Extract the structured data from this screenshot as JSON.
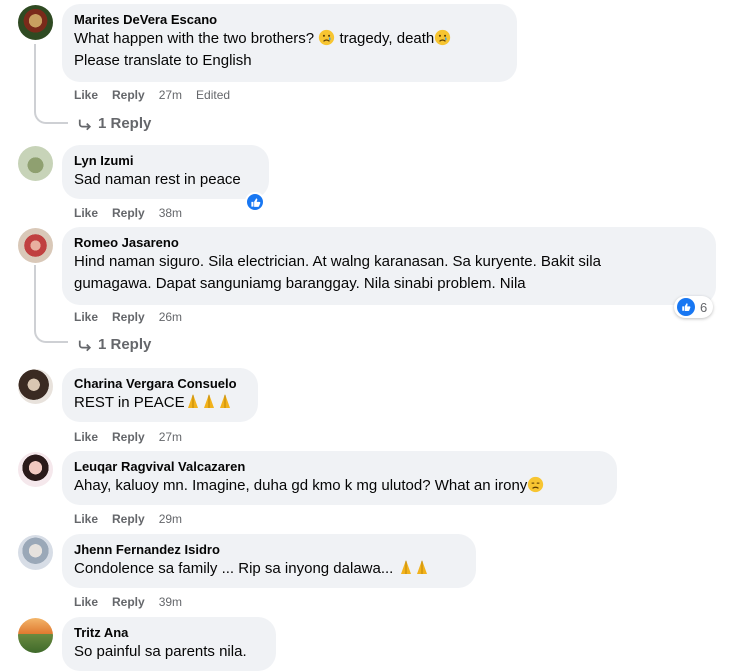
{
  "actions": {
    "like": "Like",
    "reply": "Reply",
    "edited": "Edited"
  },
  "comments": [
    {
      "author": "Marites DeVera Escano",
      "line1": "What happen with the two brothers?",
      "line1b": "tragedy, death",
      "line2": "Please translate to English",
      "time": "27m",
      "replies": "1 Reply"
    },
    {
      "author": "Lyn Izumi",
      "line1": "Sad naman rest in peace",
      "time": "38m"
    },
    {
      "author": "Romeo Jasareno",
      "line1": "Hind naman siguro. Sila electrician. At walng karanasan. Sa kuryente. Bakit sila",
      "line2": "gumagawa. Dapat sanguniamg baranggay. Nila sinabi problem. Nila",
      "time": "26m",
      "reaction_count": "6",
      "replies": "1 Reply"
    },
    {
      "author": "Charina Vergara Consuelo",
      "line1": "REST in PEACE",
      "time": "27m"
    },
    {
      "author": "Leuqar Ragvival Valcazaren",
      "line1": "Ahay, kaluoy mn. Imagine, duha gd kmo k mg ulutod? What an irony",
      "time": "29m"
    },
    {
      "author": "Jhenn Fernandez Isidro",
      "line1": "Condolence sa family ... Rip sa inyong dalawa...",
      "time": "39m"
    },
    {
      "author": "Tritz Ana",
      "line1": "So painful sa parents nila."
    }
  ],
  "colors": {
    "bubble": "#f0f2f5",
    "meta": "#65676b",
    "like_blue": "#1877f2"
  }
}
